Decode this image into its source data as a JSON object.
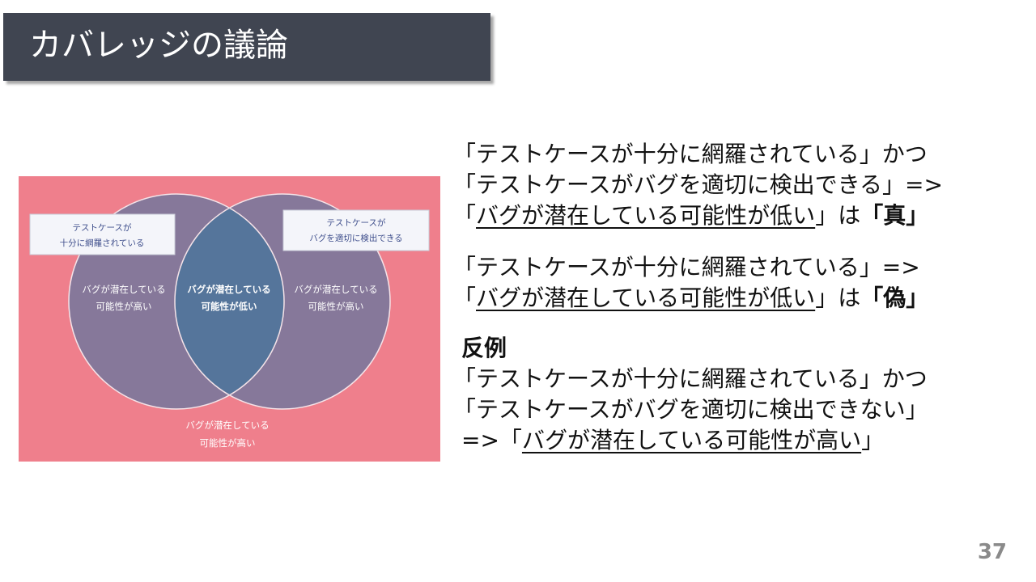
{
  "slide": {
    "title": "カバレッジの議論",
    "page_number": "37"
  },
  "venn": {
    "colors": {
      "background": "#ef7f8c",
      "circle": "#86789a",
      "overlap": "#55759b",
      "circle_outline": "#f5e3e8",
      "label_box": "#f4f5fa",
      "label_box_text": "#3f4f8c"
    },
    "left_box": [
      "テストケースが",
      "十分に網羅されている"
    ],
    "right_box": [
      "テストケースが",
      "バグを適切に検出できる"
    ],
    "left_region": [
      "バグが潜在している",
      "可能性が高い"
    ],
    "center_region": [
      "バグが潜在している",
      "可能性が低い"
    ],
    "right_region": [
      "バグが潜在している",
      "可能性が高い"
    ],
    "outside_region": [
      "バグが潜在している",
      "可能性が高い"
    ]
  },
  "statements": {
    "p1": {
      "l1": "「テストケースが十分に網羅されている」かつ",
      "l2": "「テストケースがバグを適切に検出できる」=>",
      "l3_open": "「",
      "l3_u": "バグが潜在している可能性が低い",
      "l3_mid": "」は",
      "l3_b": "「真」"
    },
    "p2": {
      "l1": "「テストケースが十分に網羅されている」=>",
      "l2_open": "「",
      "l2_u": "バグが潜在している可能性が低い",
      "l2_mid": "」は",
      "l2_b": "「偽」"
    },
    "p3": {
      "heading": "反例",
      "l1": "「テストケースが十分に網羅されている」かつ",
      "l2": "「テストケースがバグを適切に検出できない」",
      "l3_pre": "=>「",
      "l3_u": "バグが潜在している可能性が高い",
      "l3_close": "」"
    }
  }
}
